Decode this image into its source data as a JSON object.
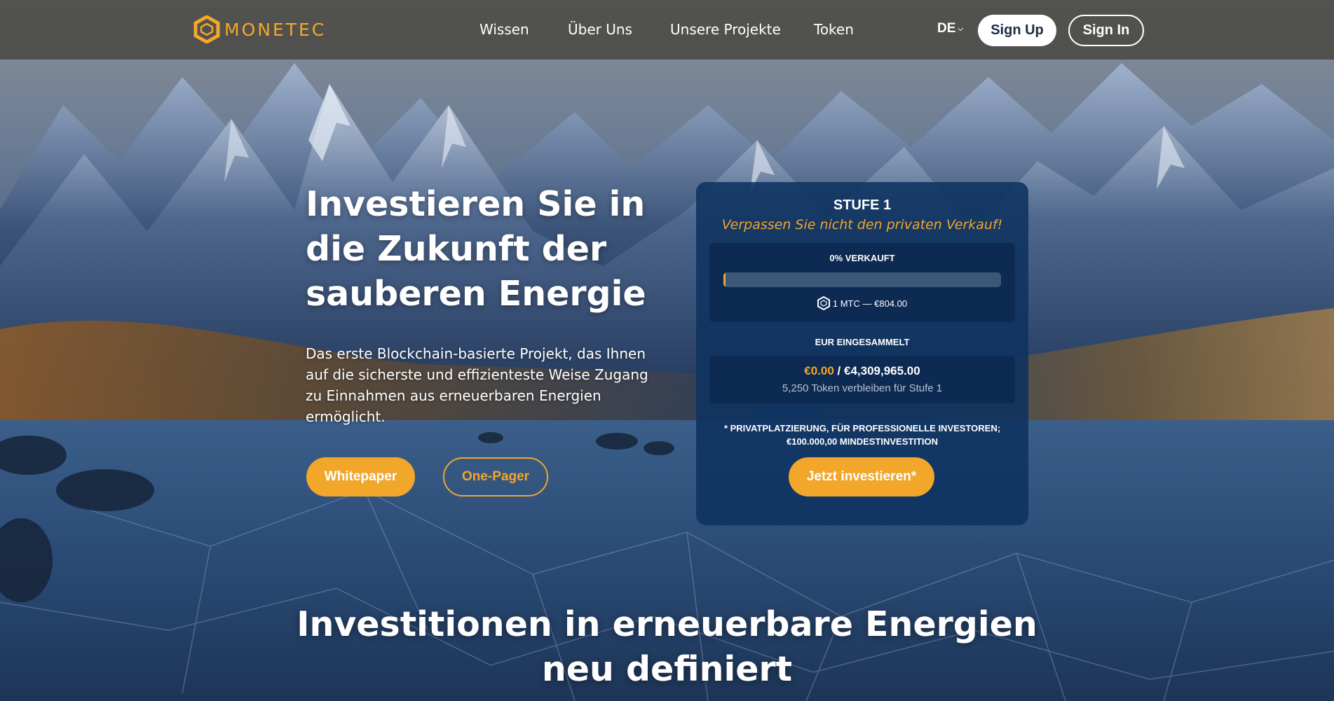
{
  "brand": {
    "name": "MONETEC",
    "accent": "#f2a62a"
  },
  "nav": {
    "items": [
      "Wissen",
      "Über Uns",
      "Unsere Projekte",
      "Token"
    ],
    "language": "DE",
    "sign_up": "Sign Up",
    "sign_in": "Sign In"
  },
  "hero": {
    "title": "Investieren Sie in die Zukunft der sauberen Energie",
    "description": "Das erste Blockchain-basierte Projekt, das Ihnen auf die sicherste und effizienteste Weise Zugang zu Einnahmen aus erneuerbaren Energien ermöglicht.",
    "whitepaper_label": "Whitepaper",
    "onepager_label": "One-Pager"
  },
  "sale_card": {
    "stage": "STUFE 1",
    "subtitle": "Verpassen Sie nicht den privaten Verkauf!",
    "sold_label": "0% VERKAUFT",
    "sold_fraction": 0,
    "token_price": "1 MTC — €804.00",
    "raised_label": "EUR EINGESAMMELT",
    "raised_current": "€0.00",
    "raised_separator": " / ",
    "raised_target": "€4,309,965.00",
    "tokens_remaining": "5,250 Token verbleiben für Stufe 1",
    "note_line1": "* PRIVATPLATZIERUNG, FÜR PROFESSIONELLE INVESTOREN;",
    "note_line2": "€100.000,00 MINDESTINVESTITION",
    "invest_label": "Jetzt investieren*"
  },
  "section": {
    "title_line1": "Investitionen in erneuerbare Energien",
    "title_line2": "neu definiert"
  }
}
